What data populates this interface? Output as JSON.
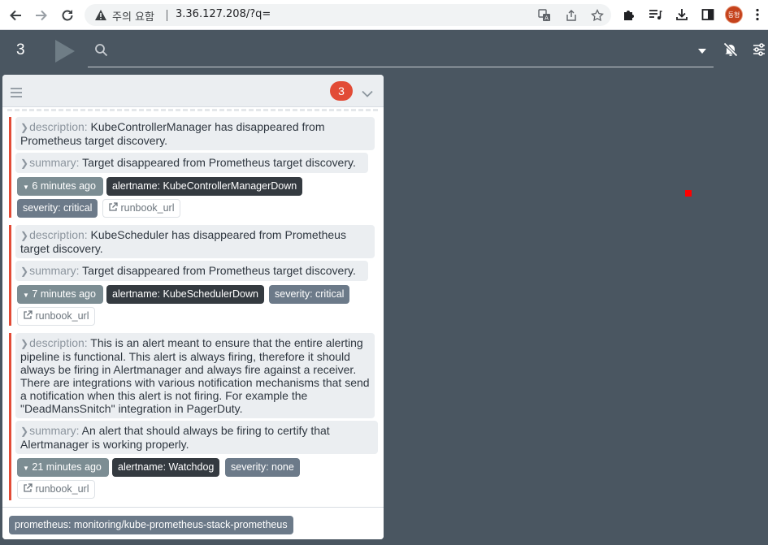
{
  "browser": {
    "security_label": "주의 요함",
    "url": "3.36.127.208/?q=",
    "profile_initials": "동형"
  },
  "toolbar": {
    "alert_count": "3",
    "search_placeholder": ""
  },
  "group": {
    "count": "3",
    "alerts": [
      {
        "description_key": "description:",
        "description": "KubeControllerManager has disappeared from Prometheus target discovery.",
        "summary_key": "summary:",
        "summary": "Target disappeared from Prometheus target discovery.",
        "age": "6 minutes ago",
        "alertname": "alertname: KubeControllerManagerDown",
        "severity": "severity: critical",
        "runbook": "runbook_url"
      },
      {
        "description_key": "description:",
        "description": "KubeScheduler has disappeared from Prometheus target discovery.",
        "summary_key": "summary:",
        "summary": "Target disappeared from Prometheus target discovery.",
        "age": "7 minutes ago",
        "alertname": "alertname: KubeSchedulerDown",
        "severity": "severity: critical",
        "runbook": "runbook_url"
      },
      {
        "description_key": "description:",
        "description": "This is an alert meant to ensure that the entire alerting pipeline is functional. This alert is always firing, therefore it should always be firing in Alertmanager and always fire against a receiver. There are integrations with various notification mechanisms that send a notification when this alert is not firing. For example the \"DeadMansSnitch\" integration in PagerDuty.",
        "summary_key": "summary:",
        "summary": "An alert that should always be firing to certify that Alertmanager is working properly.",
        "age": "21 minutes ago",
        "alertname": "alertname: Watchdog",
        "severity": "severity: none",
        "runbook": "runbook_url"
      }
    ],
    "footer_label": "prometheus: monitoring/kube-prometheus-stack-prometheus"
  },
  "colors": {
    "background": "#4a5661",
    "accent_red": "#e24b36",
    "label_dark": "#343a40",
    "label_gray": "#7c8d93"
  }
}
